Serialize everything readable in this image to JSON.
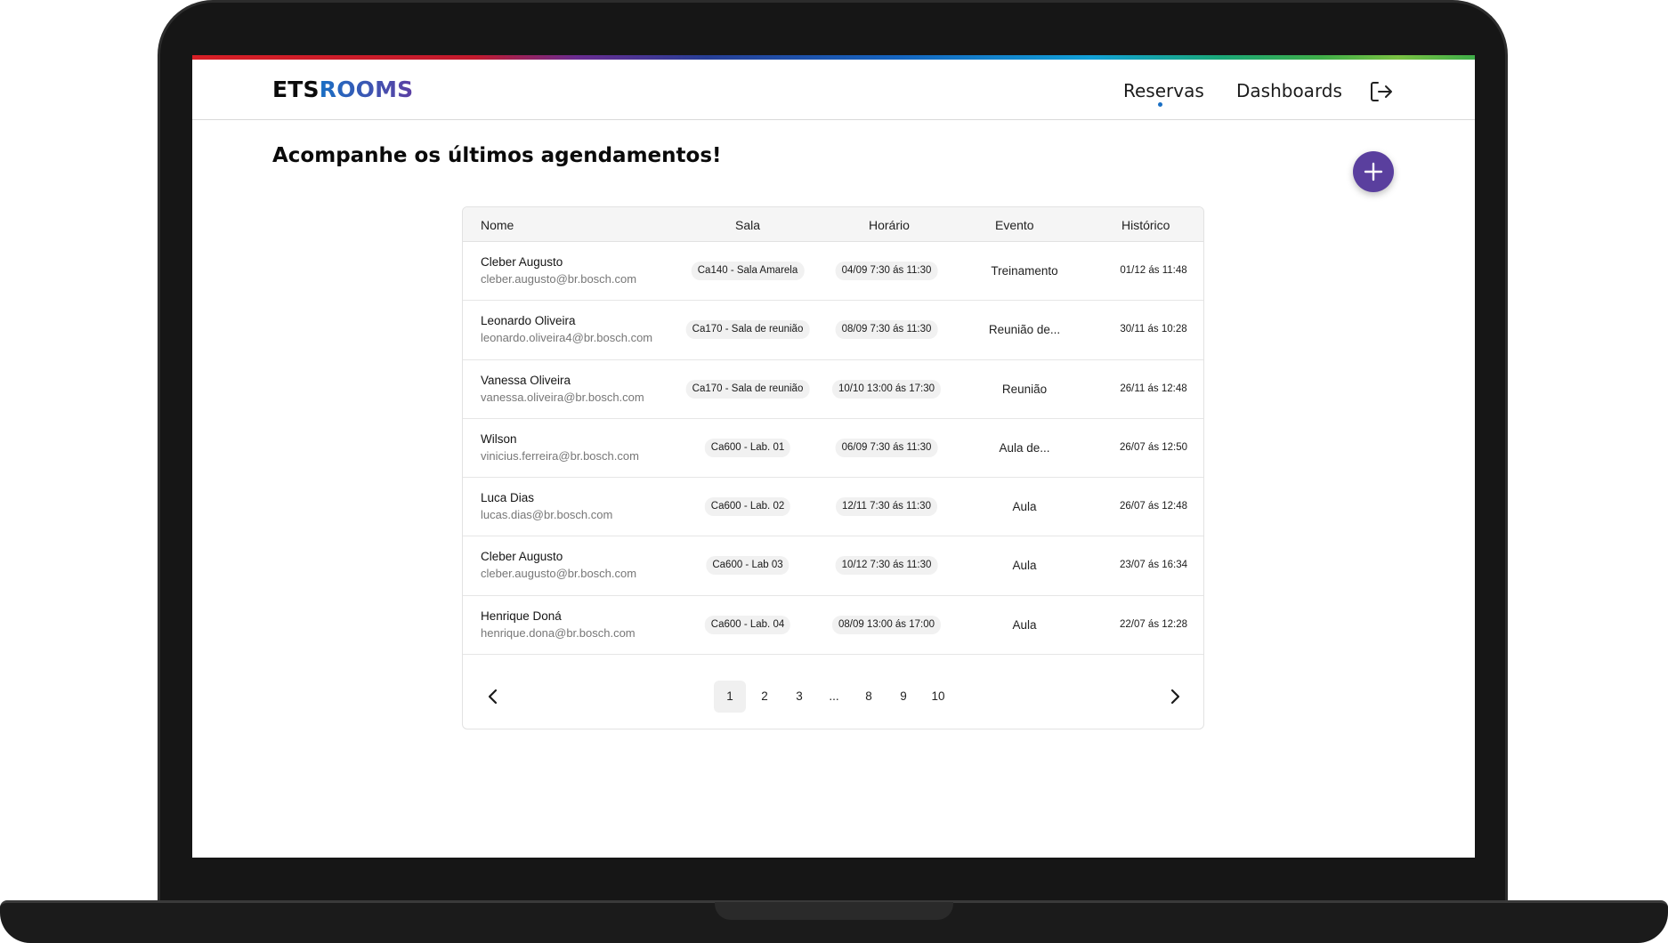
{
  "app": {
    "logo_part1": "ETS",
    "logo_part2": "ROOMS",
    "brand_gradient": [
      "#1a6fc4",
      "#5c3fa3"
    ],
    "accent_color": "#5a3f9e"
  },
  "nav": {
    "reservas": "Reservas",
    "dashboards": "Dashboards",
    "active": "Reservas",
    "logout_icon": "logout-icon"
  },
  "page": {
    "title": "Acompanhe os últimos agendamentos!",
    "add_icon": "plus-icon"
  },
  "table": {
    "columns": [
      "Nome",
      "Sala",
      "Horário",
      "Evento",
      "Histórico"
    ],
    "rows": [
      {
        "name": "Cleber Augusto",
        "email": "cleber.augusto@br.bosch.com",
        "sala": "Ca140 - Sala Amarela",
        "horario": "04/09 7:30 ás 11:30",
        "evento": "Treinamento",
        "historico": "01/12 ás 11:48"
      },
      {
        "name": "Leonardo Oliveira",
        "email": "leonardo.oliveira4@br.bosch.com",
        "sala": "Ca170 - Sala de reunião",
        "horario": "08/09 7:30 ás 11:30",
        "evento": "Reunião de...",
        "historico": "30/11 ás 10:28"
      },
      {
        "name": "Vanessa Oliveira",
        "email": "vanessa.oliveira@br.bosch.com",
        "sala": "Ca170 - Sala de reunião",
        "horario": "10/10 13:00 ás 17:30",
        "evento": "Reunião",
        "historico": "26/11 ás 12:48"
      },
      {
        "name": "Wilson",
        "email": "vinicius.ferreira@br.bosch.com",
        "sala": "Ca600 - Lab. 01",
        "horario": "06/09 7:30 ás 11:30",
        "evento": "Aula de...",
        "historico": "26/07 ás 12:50"
      },
      {
        "name": "Luca Dias",
        "email": "lucas.dias@br.bosch.com",
        "sala": "Ca600 - Lab. 02",
        "horario": "12/11 7:30 ás 11:30",
        "evento": "Aula",
        "historico": "26/07 ás 12:48"
      },
      {
        "name": "Cleber Augusto",
        "email": "cleber.augusto@br.bosch.com",
        "sala": "Ca600 - Lab 03",
        "horario": "10/12 7:30 ás 11:30",
        "evento": "Aula",
        "historico": "23/07 ás 16:34"
      },
      {
        "name": "Henrique Doná",
        "email": "henrique.dona@br.bosch.com",
        "sala": "Ca600 - Lab. 04",
        "horario": "08/09 13:00 ás 17:00",
        "evento": "Aula",
        "historico": "22/07 ás 12:28"
      }
    ]
  },
  "pagination": {
    "pages": [
      "1",
      "2",
      "3",
      "...",
      "8",
      "9",
      "10"
    ],
    "current": "1",
    "prev_icon": "chevron-left-icon",
    "next_icon": "chevron-right-icon"
  }
}
